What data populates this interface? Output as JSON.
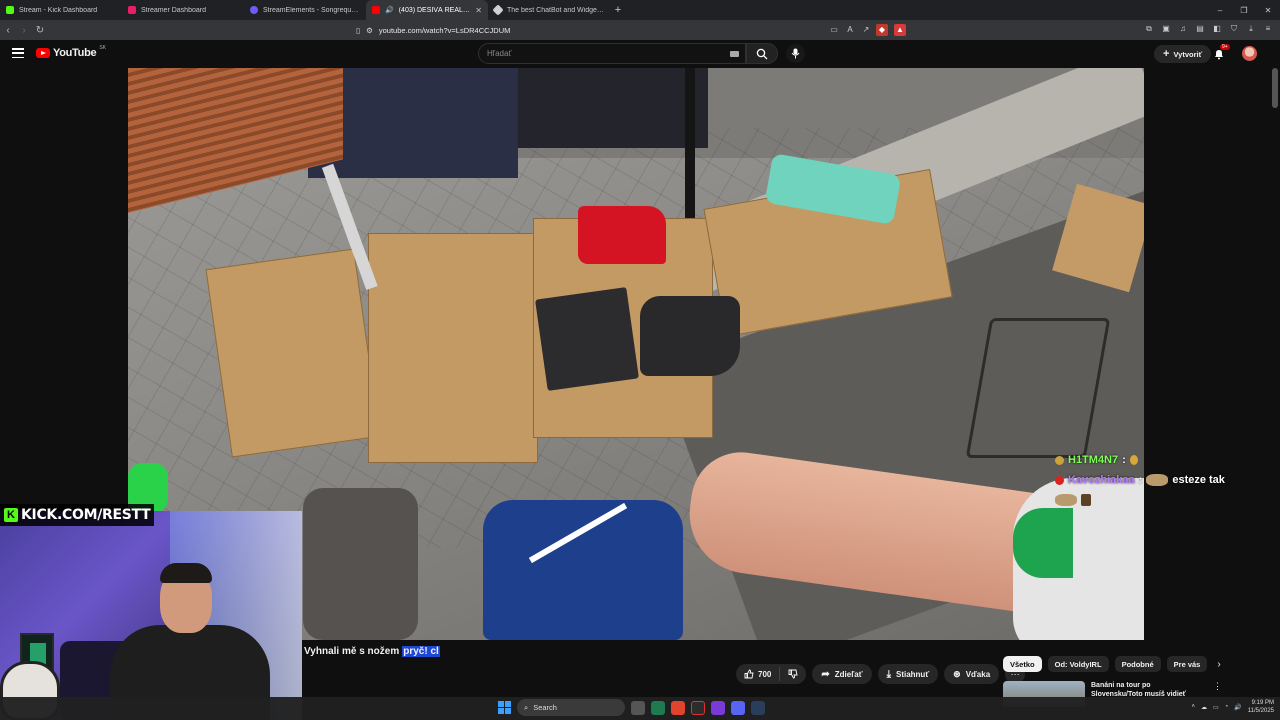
{
  "browser": {
    "tabs": [
      {
        "title": "Stream - Kick Dashboard",
        "color": "#53fc18",
        "active": false
      },
      {
        "title": "Streamer Dashboard",
        "color": "#e91e63",
        "active": false
      },
      {
        "title": "StreamElements - Songrequest",
        "color": "#6a5cff",
        "active": false
      },
      {
        "title": "(403) DĚSIVÁ REALITA CHILE…",
        "color": "#ff0000",
        "active": true
      },
      {
        "title": "The best ChatBot and Widgets for Ki…",
        "color": "#cfcfcf",
        "active": false
      }
    ],
    "url": "youtube.com/watch?v=LsDR4CCJDUM"
  },
  "youtube": {
    "logo_text": "YouTube",
    "country_code": "SK",
    "search_placeholder": "Hľadať",
    "create_label": "Vytvoriť",
    "notif_badge": "9+"
  },
  "chat": [
    {
      "user": "H1TM4N7",
      "sep": ":",
      "message": ""
    },
    {
      "user": "Kavozhiakaa",
      "sep": ":",
      "message": "esteze tak"
    }
  ],
  "kick_overlay": {
    "url_text": "KICK.COM/RESTT",
    "logo_letter": "K"
  },
  "subtitle": {
    "text": "Vyhnali mě s nožem",
    "highlight": "pryč! cl"
  },
  "actions": {
    "likes": "700",
    "share": "Zdieľať",
    "download": "Stiahnuť",
    "thanks": "Vďaka"
  },
  "chips": [
    "Všetko",
    "Od: VoldyIRL",
    "Podobné",
    "Pre vás"
  ],
  "recommendation": {
    "title": "Banáni na tour po Slovensku/Toto musíš vidieť"
  },
  "taskbar": {
    "search_label": "Search",
    "time": "9:19 PM",
    "date": "11/5/2025"
  }
}
